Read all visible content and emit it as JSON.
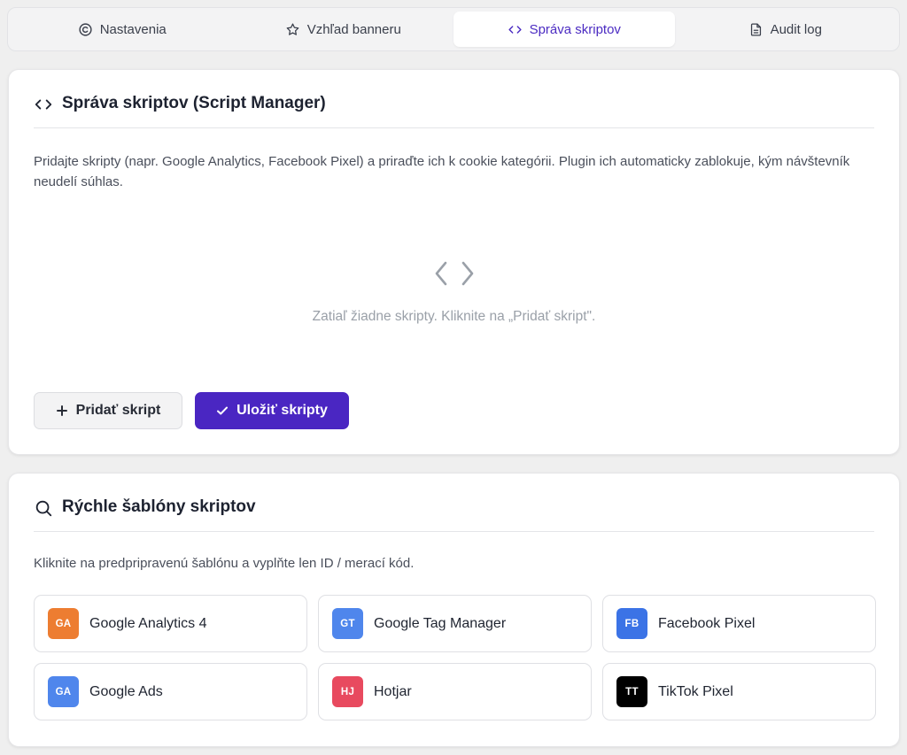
{
  "tabs": [
    {
      "label": "Nastavenia",
      "icon": "copyright-icon",
      "active": false
    },
    {
      "label": "Vzhľad banneru",
      "icon": "star-icon",
      "active": false
    },
    {
      "label": "Správa skriptov",
      "icon": "code-icon",
      "active": true
    },
    {
      "label": "Audit log",
      "icon": "document-icon",
      "active": false
    }
  ],
  "script_manager": {
    "title": "Správa skriptov (Script Manager)",
    "description": "Pridajte skripty (napr. Google Analytics, Facebook Pixel) a priraďte ich k cookie kategórii. Plugin ich automaticky zablokuje, kým návštevník neudelí súhlas.",
    "empty_text": "Zatiaľ žiadne skripty. Kliknite na „Pridať skript\".",
    "add_button": "Pridať skript",
    "save_button": "Uložiť skripty"
  },
  "templates": {
    "title": "Rýchle šablóny skriptov",
    "description": "Kliknite na predpripravenú šablónu a vyplňte len ID / merací kód.",
    "items": [
      {
        "badge": "GA",
        "name": "Google Analytics 4",
        "color": "#ed7d31"
      },
      {
        "badge": "GT",
        "name": "Google Tag Manager",
        "color": "#4f86ec"
      },
      {
        "badge": "FB",
        "name": "Facebook Pixel",
        "color": "#3b73e6"
      },
      {
        "badge": "GA",
        "name": "Google Ads",
        "color": "#4f86ec"
      },
      {
        "badge": "HJ",
        "name": "Hotjar",
        "color": "#e84a5f"
      },
      {
        "badge": "TT",
        "name": "TikTok Pixel",
        "color": "#000000"
      }
    ]
  },
  "colors": {
    "accent": "#4a26c2",
    "background": "#efefef"
  }
}
